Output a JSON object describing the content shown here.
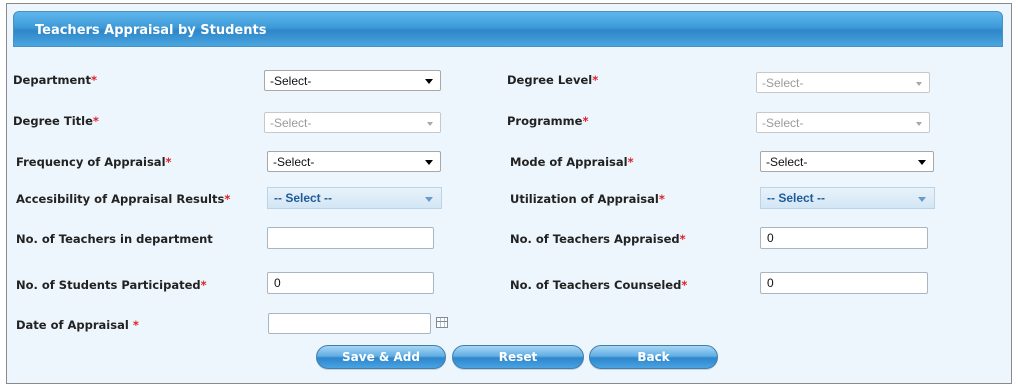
{
  "panel": {
    "title": "Teachers Appraisal by Students"
  },
  "required_marker": "*",
  "fields": {
    "department": {
      "label": "Department",
      "value": "-Select-"
    },
    "degree_level": {
      "label": "Degree Level",
      "value": "-Select-"
    },
    "degree_title": {
      "label": "Degree Title",
      "value": "-Select-"
    },
    "programme": {
      "label": "Programme",
      "value": "-Select-"
    },
    "frequency": {
      "label": "Frequency of Appraisal",
      "value": "-Select-"
    },
    "mode": {
      "label": "Mode of Appraisal",
      "value": "-Select-"
    },
    "accessibility": {
      "label": "Accesibility of Appraisal Results",
      "value": "-- Select --"
    },
    "utilization": {
      "label": "Utilization of Appraisal",
      "value": "-- Select --"
    },
    "teachers_in_dept": {
      "label": "No. of Teachers in department",
      "value": ""
    },
    "teachers_appraised": {
      "label": "No. of Teachers Appraised",
      "value": "0"
    },
    "students_participated": {
      "label": "No. of Students Participated",
      "value": "0"
    },
    "teachers_counseled": {
      "label": "No. of Teachers Counseled",
      "value": "0"
    },
    "date": {
      "label": "Date of Appraisal ",
      "value": ""
    }
  },
  "buttons": {
    "save_add": "Save & Add",
    "reset": "Reset",
    "back": "Back"
  },
  "icons": {
    "dropdown": "chevron-down-icon",
    "calendar": "calendar-icon"
  }
}
